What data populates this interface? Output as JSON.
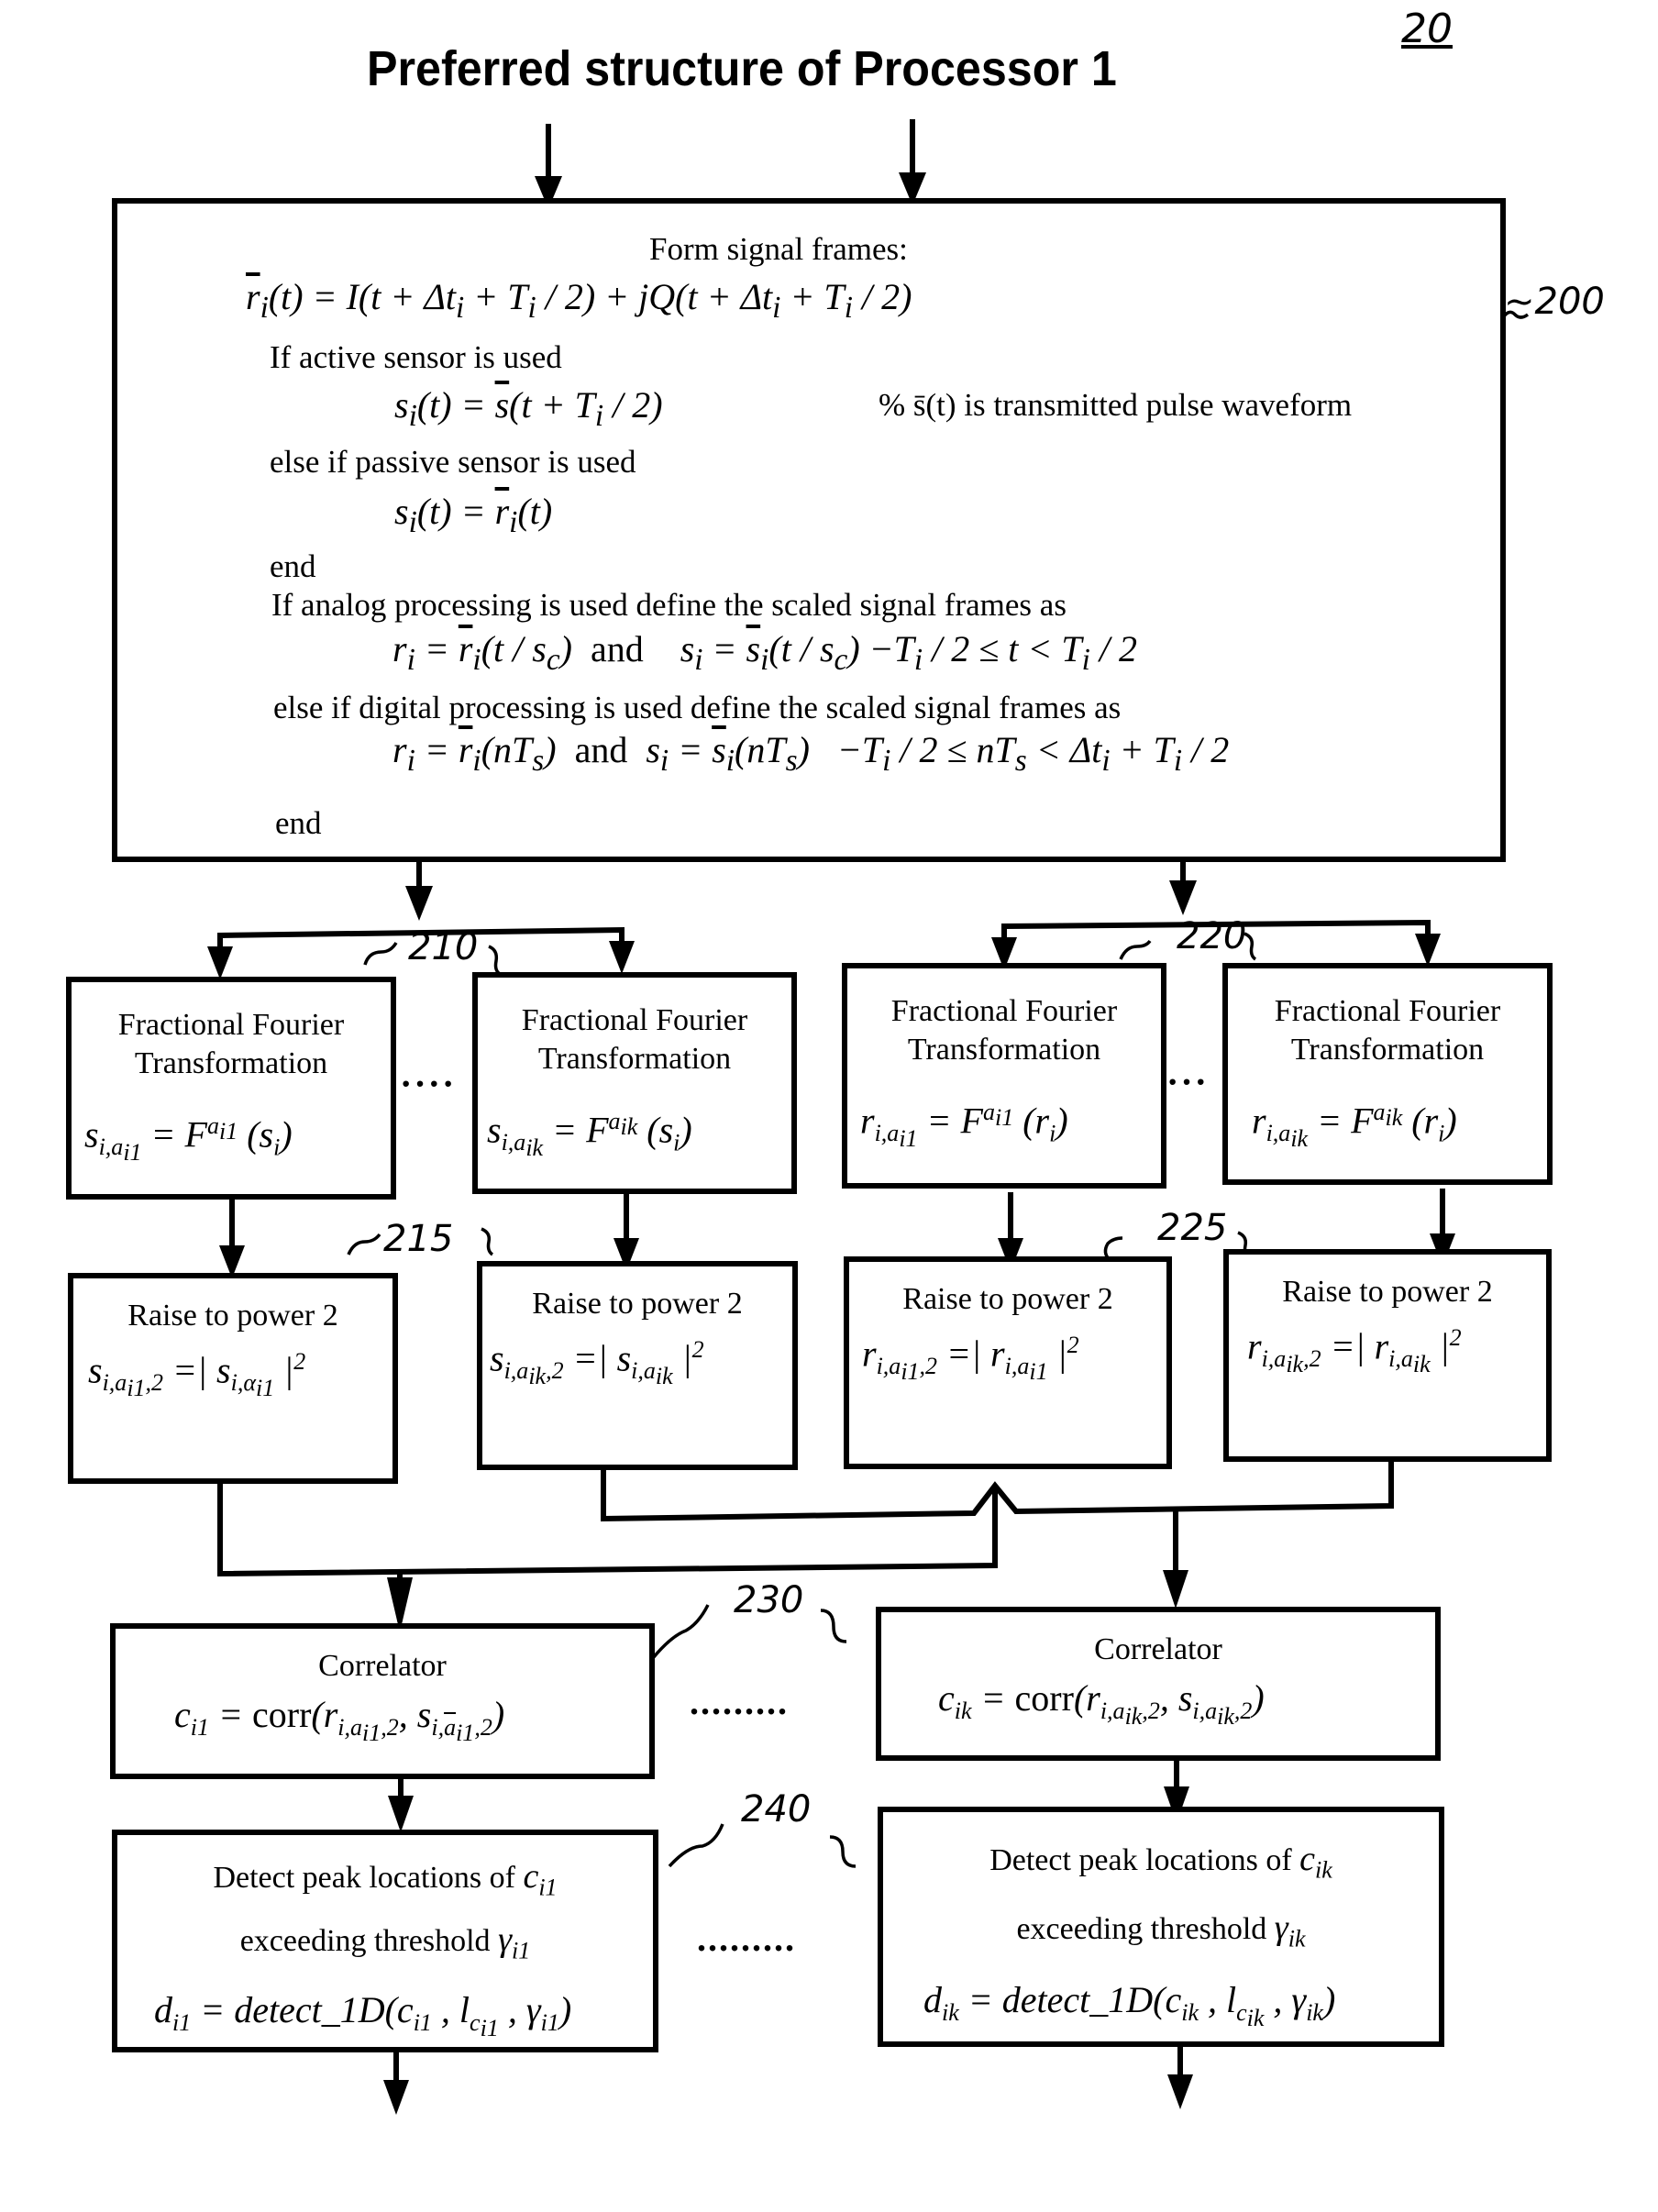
{
  "figure": {
    "title": "Preferred structure of Processor 1",
    "figure_number": "20"
  },
  "reference_numbers": {
    "form_frames": "~200",
    "frft_s": "210",
    "frft_r": "220",
    "power_s": "215",
    "power_r": "225",
    "correlator": "230",
    "detector": "240"
  },
  "frame_block": {
    "heading": "Form signal frames:",
    "eq_r": "r̄ᵢ(t) = I(t + Δtᵢ + Tᵢ / 2) + jQ(t + Δtᵢ + Tᵢ / 2)",
    "if_active": "If active sensor is used",
    "eq_s_active": "sᵢ(t) = s̄(t + Tᵢ / 2)",
    "comment": "% s̄(t)  is transmitted pulse waveform",
    "else_passive": "else if passive sensor is used",
    "eq_s_passive": "sᵢ(t) = r̄ᵢ(t)",
    "end1": "end",
    "if_analog": "If analog processing is used define the scaled signal frames as",
    "eq_analog": "rᵢ = r̄ᵢ(t / s꜀)   and    sᵢ = s̄ᵢ(t / s꜀)  −Tᵢ / 2 ≤ t < Tᵢ / 2",
    "else_digital": "else if  digital processing is used define the scaled signal frames as",
    "eq_digital": "rᵢ = r̄ᵢ(nTₛ)   and   sᵢ = s̄ᵢ(nTₛ)    −Tᵢ / 2 ≤ nTₛ < Δtᵢ + Tᵢ / 2",
    "end2": "end"
  },
  "frft_blocks": [
    {
      "label_1": "Fractional Fourier",
      "label_2": "Transformation",
      "eq": "s_{i,a_{i1}} = F^{a_{i1}} (s_i)",
      "lhs": "s",
      "lhs_sub": "i,a",
      "idx": "i1",
      "arg": "s"
    },
    {
      "label_1": "Fractional Fourier",
      "label_2": "Transformation",
      "eq": "s_{i,a_{ik}} = F^{a_{ik}} (s_i)",
      "lhs": "s",
      "lhs_sub": "i,a",
      "idx": "ik",
      "arg": "s"
    },
    {
      "label_1": "Fractional Fourier",
      "label_2": "Transformation",
      "eq": "r_{i,a_{i1}} = F^{a_{i1}} (r_i)",
      "lhs": "r",
      "lhs_sub": "i,a",
      "idx": "i1",
      "arg": "r"
    },
    {
      "label_1": "Fractional Fourier",
      "label_2": "Transformation",
      "eq": "r_{i,a_{ik}} = F^{a_{ik}} (r_i)",
      "lhs": "r",
      "lhs_sub": "i,a",
      "idx": "ik",
      "arg": "r"
    }
  ],
  "power_blocks": [
    {
      "label": "Raise to power  2",
      "eq": "s_{i,a_{i1},2} = | s_{i,α_{i1}} |^2",
      "var": "s",
      "idx": "i1"
    },
    {
      "label": "Raise to power  2",
      "eq": "s_{i,a_{ik},2} = | s_{i,a_{ik}} |^2",
      "var": "s",
      "idx": "ik"
    },
    {
      "label": "Raise to power  2",
      "eq": "r_{i,a_{i1},2} = | r_{i,a_{i1}} |^2",
      "var": "r",
      "idx": "i1"
    },
    {
      "label": "Raise to power  2",
      "eq": "r_{i,a_{ik},2} = | r_{i,a_{ik}} |^2",
      "var": "r",
      "idx": "ik"
    }
  ],
  "correlator_blocks": [
    {
      "label": "Correlator",
      "eq": "c_{i1} = corr(r_{i,a_{i1},2}, s_{i,ā_{i1},2})",
      "idx": "i1"
    },
    {
      "label": "Correlator",
      "eq": "c_{ik} = corr(r_{i,a_{ik},2}, s_{i,a_{ik},2})",
      "idx": "ik"
    }
  ],
  "detector_blocks": [
    {
      "label_1": "Detect peak locations of",
      "label_2": "exceeding threshold",
      "eq": "d_{i1} = detect_1D(c_{i1}, l_{c_{i1}}, γ_{i1})",
      "idx": "i1"
    },
    {
      "label_1": "Detect peak locations of",
      "label_2": "exceeding threshold",
      "eq": "d_{ik} = detect_1D(c_{ik}, l_{c_{ik}}, γ_{ik})",
      "idx": "ik"
    }
  ],
  "ellipses": {
    "frft_s": "····",
    "frft_r": "···",
    "correlator": ".........",
    "detector": "........."
  }
}
